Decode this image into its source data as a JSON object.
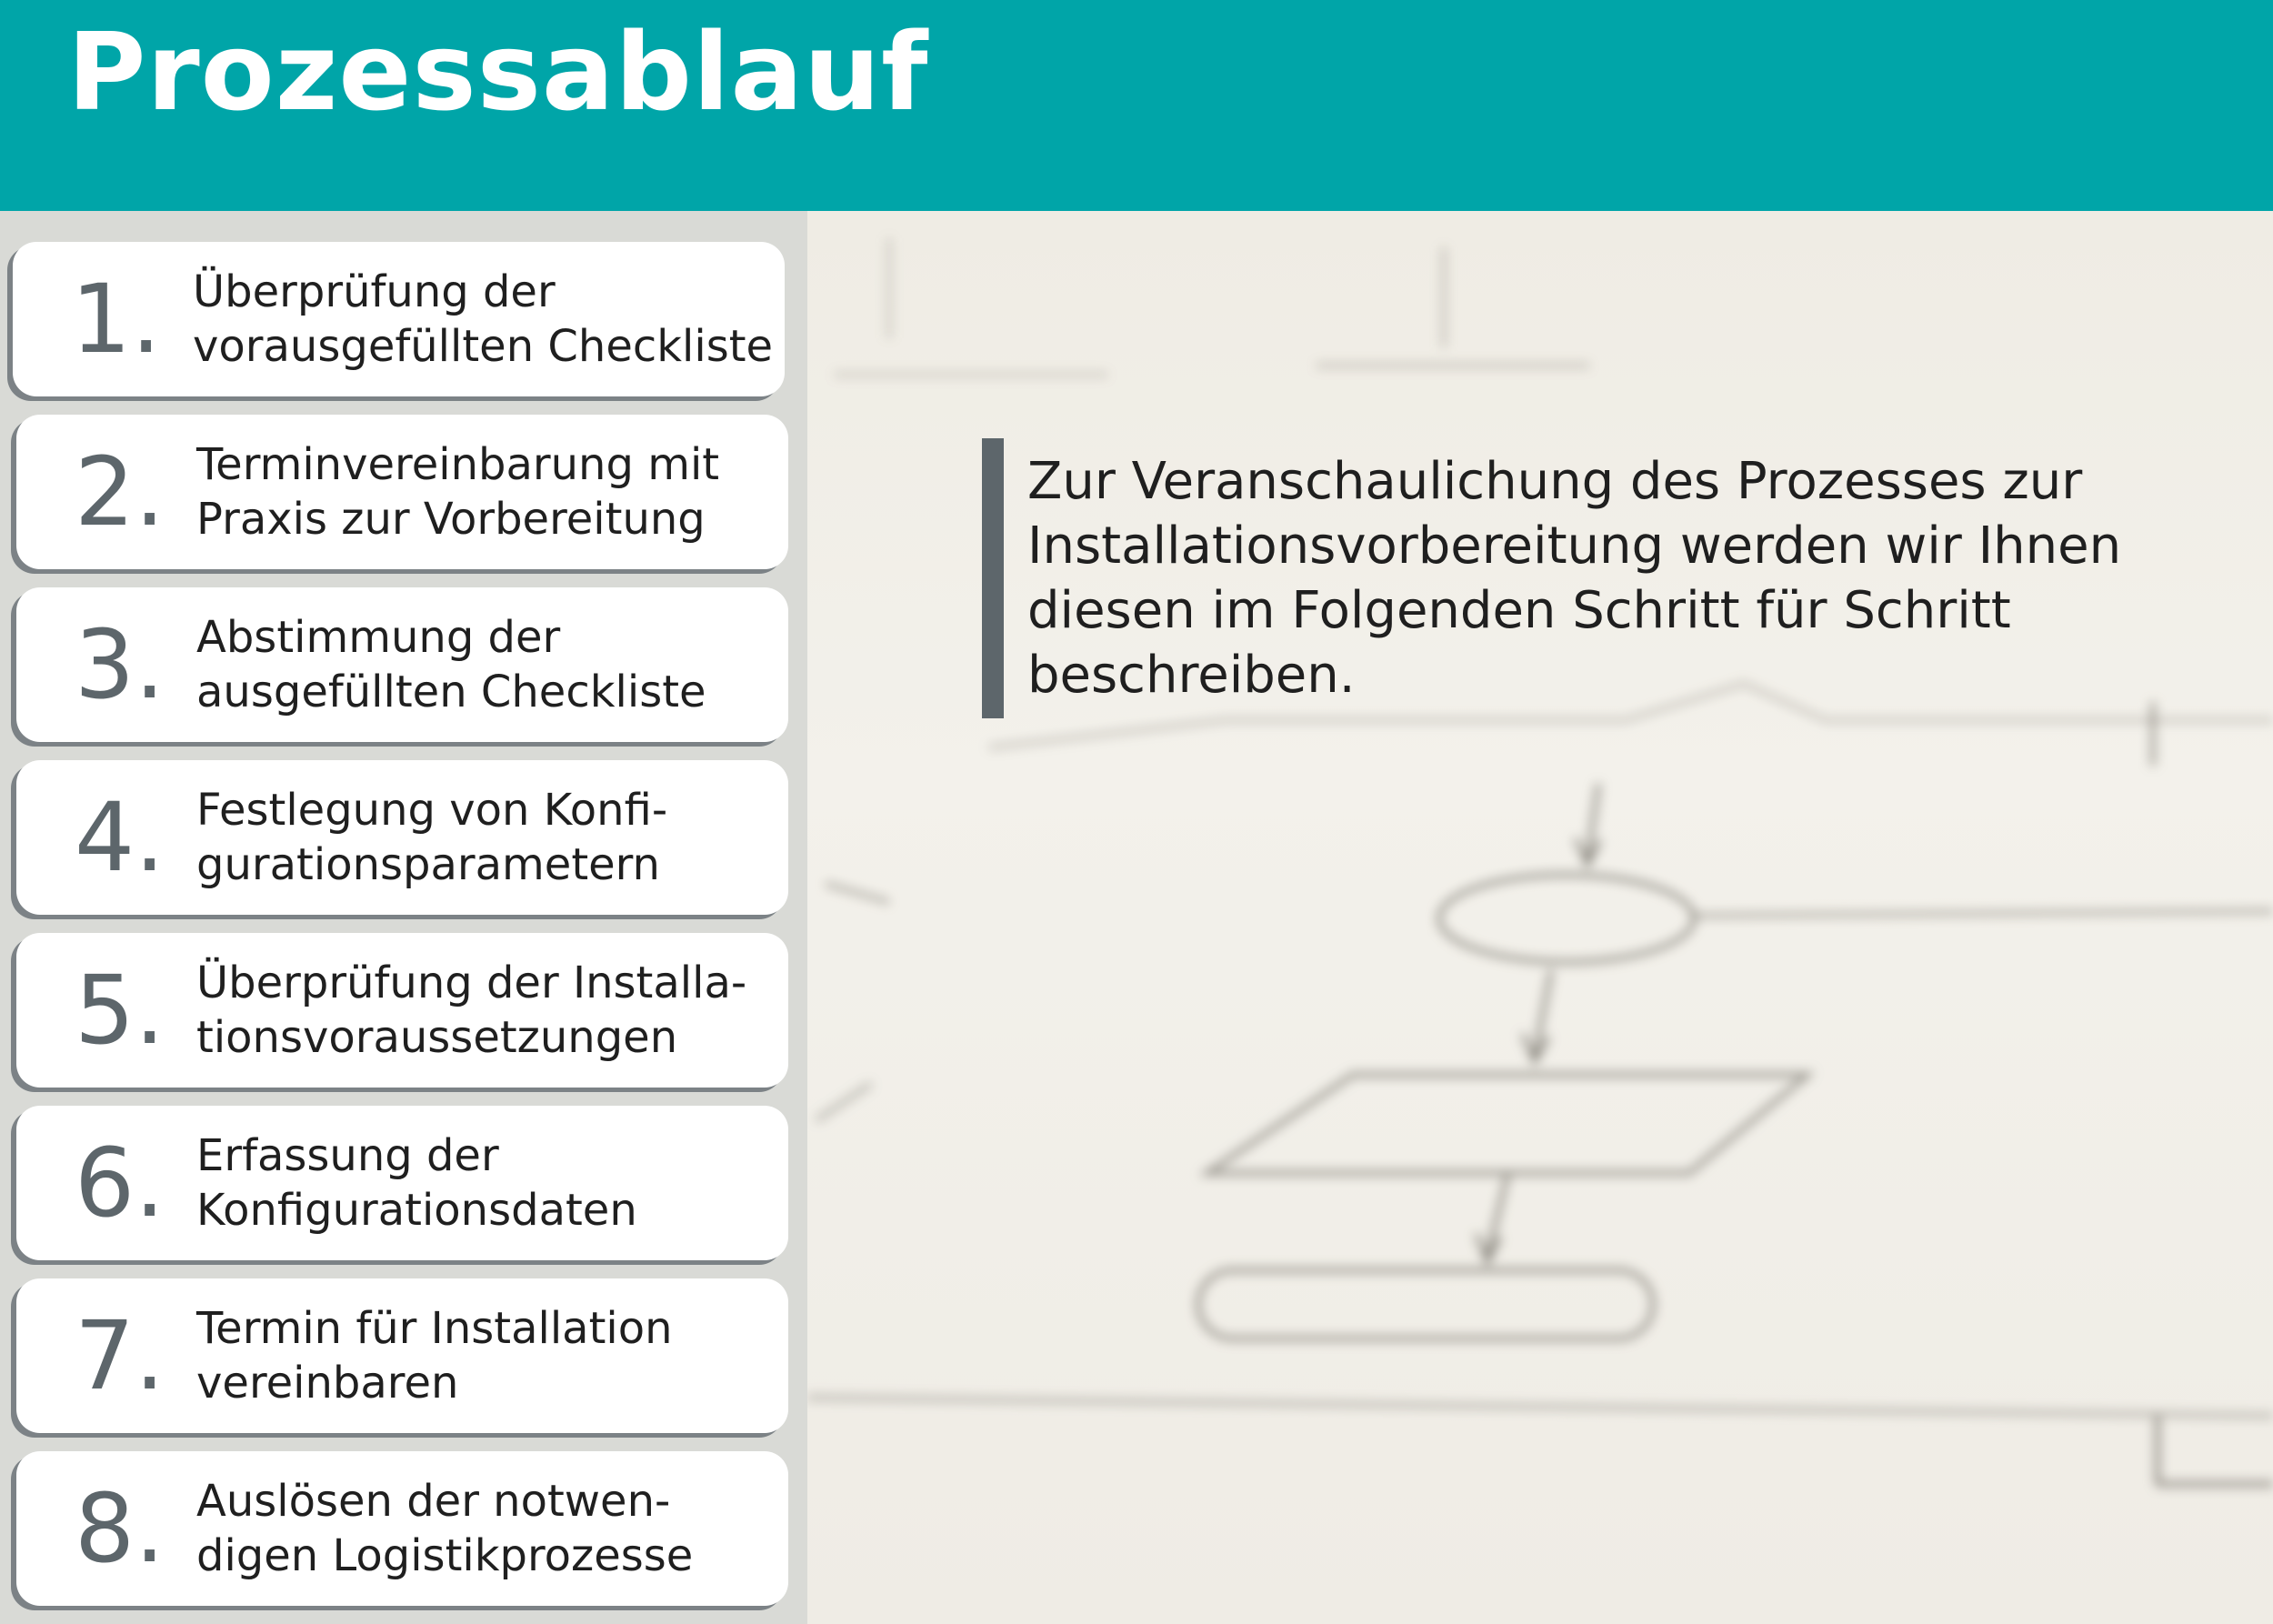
{
  "header": {
    "title": "Prozessablauf",
    "color": "#00a5a8"
  },
  "steps": [
    {
      "number": "1.",
      "text": "Überprüfung der\nvorausgefüllten Checkliste"
    },
    {
      "number": "2.",
      "text": "Terminvereinbarung mit\nPraxis zur Vorbereitung"
    },
    {
      "number": "3.",
      "text": "Abstimmung der\nausgefüllten Checkliste"
    },
    {
      "number": "4.",
      "text": "Festlegung von Konfi-\ngurationsparametern"
    },
    {
      "number": "5.",
      "text": "Überprüfung der Installa-\ntionsvoraussetzungen"
    },
    {
      "number": "6.",
      "text": "Erfassung der\nKonfigurationsdaten"
    },
    {
      "number": "7.",
      "text": "Termin für Installation\nvereinbaren"
    },
    {
      "number": "8.",
      "text": "Auslösen der notwen-\ndigen Logistikprozesse"
    }
  ],
  "intro": {
    "text": "Zur Veranschaulichung des Prozesses zur Installationsvorbereitung werden wir Ihnen diesen im Folgenden Schritt für Schritt beschreiben."
  },
  "background": {
    "description_icon": "flowchart-sketch-icon"
  }
}
